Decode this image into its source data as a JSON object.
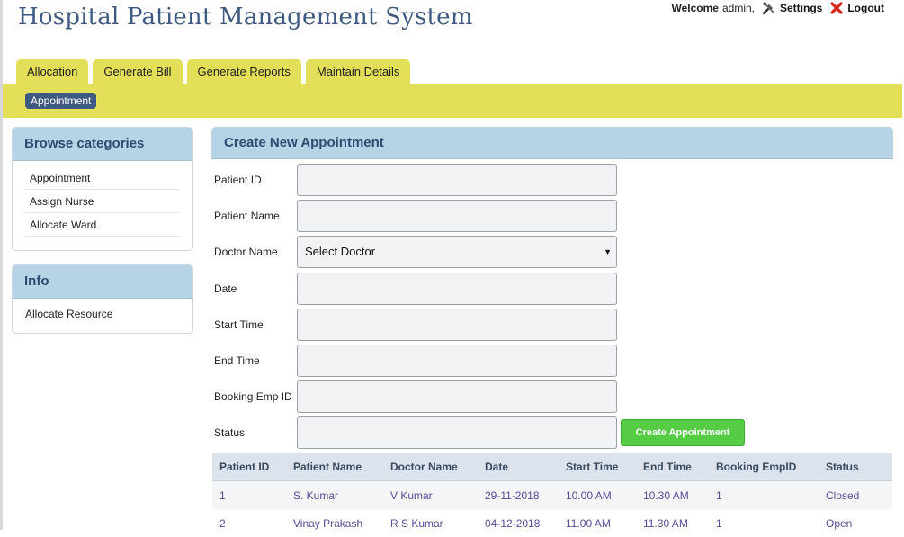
{
  "app": {
    "title": "Hospital Patient Management System"
  },
  "userbar": {
    "welcome": "Welcome",
    "username": "admin,",
    "settings": "Settings",
    "logout": "Logout"
  },
  "tabs": [
    "Allocation",
    "Generate Bill",
    "Generate Reports",
    "Maintain Details"
  ],
  "subnav": {
    "active": "Appointment"
  },
  "sidebar": {
    "categories_title": "Browse categories",
    "categories": [
      "Appointment",
      "Assign Nurse",
      "Allocate Ward"
    ],
    "info_title": "Info",
    "info_items": [
      "Allocate Resource"
    ]
  },
  "form": {
    "title": "Create New Appointment",
    "fields": {
      "patient_id": {
        "label": "Patient ID",
        "value": ""
      },
      "patient_name": {
        "label": "Patient Name",
        "value": ""
      },
      "doctor_name": {
        "label": "Doctor Name",
        "selected": "Select Doctor"
      },
      "date": {
        "label": "Date",
        "value": ""
      },
      "start_time": {
        "label": "Start Time",
        "value": ""
      },
      "end_time": {
        "label": "End Time",
        "value": ""
      },
      "booking_emp_id": {
        "label": "Booking Emp ID",
        "value": ""
      },
      "status": {
        "label": "Status",
        "value": ""
      }
    },
    "submit_label": "Create Appointment"
  },
  "table": {
    "headers": [
      "Patient ID",
      "Patient Name",
      "Doctor Name",
      "Date",
      "Start Time",
      "End Time",
      "Booking EmpID",
      "Status"
    ],
    "rows": [
      [
        "1",
        "S. Kumar",
        "V Kumar",
        "29-11-2018",
        "10.00 AM",
        "10.30 AM",
        "1",
        "Closed"
      ],
      [
        "2",
        "Vinay Prakash",
        "R S Kumar",
        "04-12-2018",
        "11.00 AM",
        "11.30 AM",
        "1",
        "Open"
      ]
    ]
  },
  "colors": {
    "accent": "#e3df58",
    "brand": "#3f5a80",
    "panel_header": "#b7d3e6",
    "button": "#55cc44",
    "table_text": "#5a4a9a"
  },
  "icons": {
    "settings": "tools-icon",
    "logout": "close-x-icon",
    "select": "caret-down-icon"
  }
}
